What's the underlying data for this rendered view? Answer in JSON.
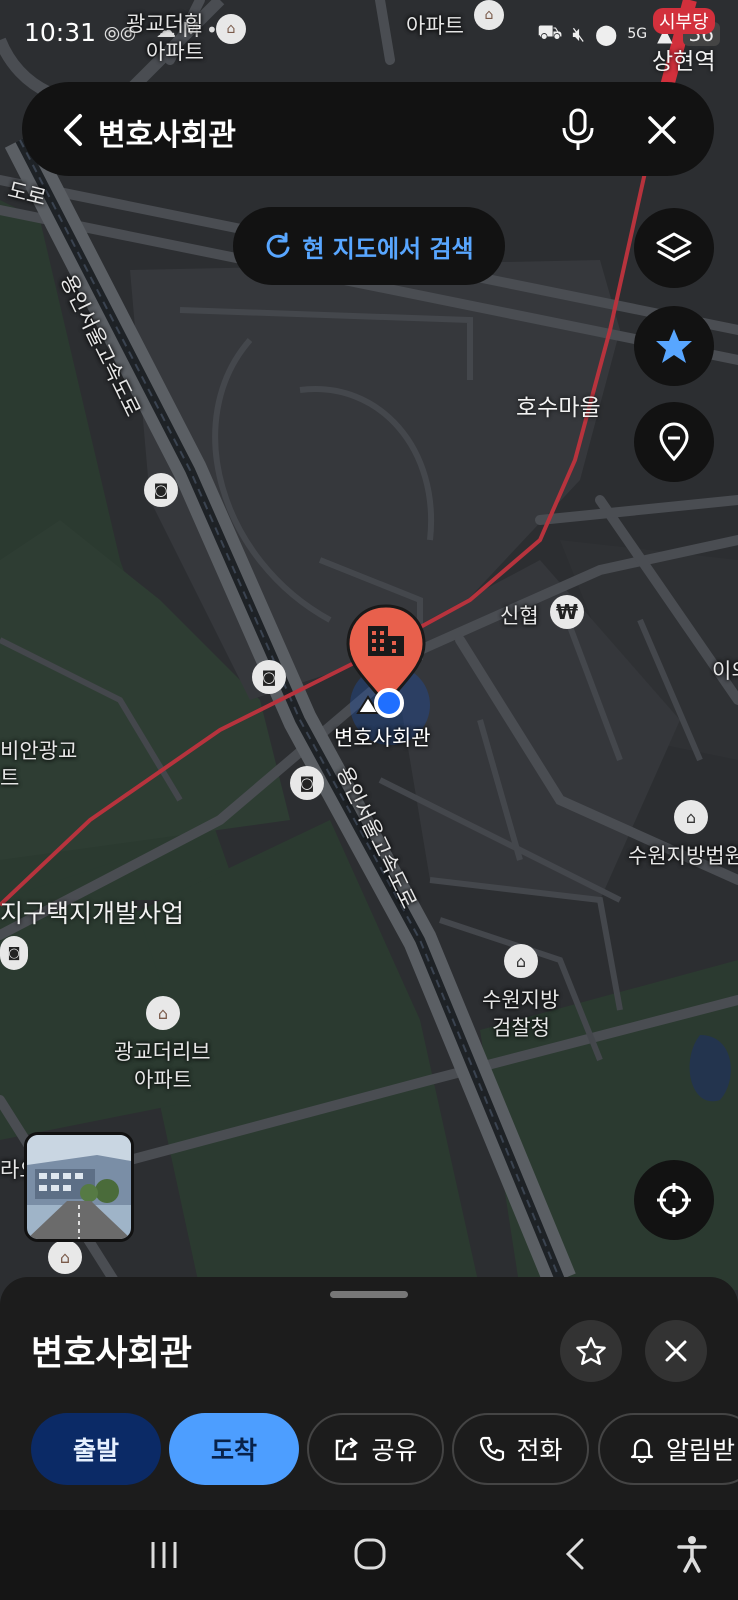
{
  "status_bar": {
    "time": "10:31",
    "network": "5G",
    "battery": "36",
    "top_right_station": "상현역",
    "top_right_badge": "시부당"
  },
  "search": {
    "query": "변호사회관",
    "research_label": "현 지도에서 검색"
  },
  "map_labels": {
    "apt_top_left": "광교더힐",
    "apt_top_left_2": "아파트",
    "apt_top_mid": "아파트",
    "road_top_left": "도로",
    "expressway_1": "용인서울고속도로",
    "expressway_2": "용인서울고속도로",
    "village": "호수마을",
    "shinhyup": "신협",
    "district_left": "비안광교",
    "district_left_2": "트",
    "dev_project": "지구택지개발사업",
    "apt_bottom": "광교더리브",
    "apt_bottom_2": "아파트",
    "court": "수원지방법원",
    "prosecutor": "수원지방",
    "prosecutor_2": "검찰청",
    "right_edge": "이의",
    "left_edge_bottom": "라오",
    "selected_place": "변호사회관"
  },
  "sheet": {
    "title": "변호사회관",
    "buttons": {
      "depart": "출발",
      "arrive": "도착",
      "share": "공유",
      "call": "전화",
      "alert": "알림받"
    }
  },
  "colors": {
    "accent_blue": "#58a6ff",
    "depart_bg": "#0b2a66",
    "arrive_bg": "#4d9eff",
    "marker_red": "#e8604c"
  }
}
